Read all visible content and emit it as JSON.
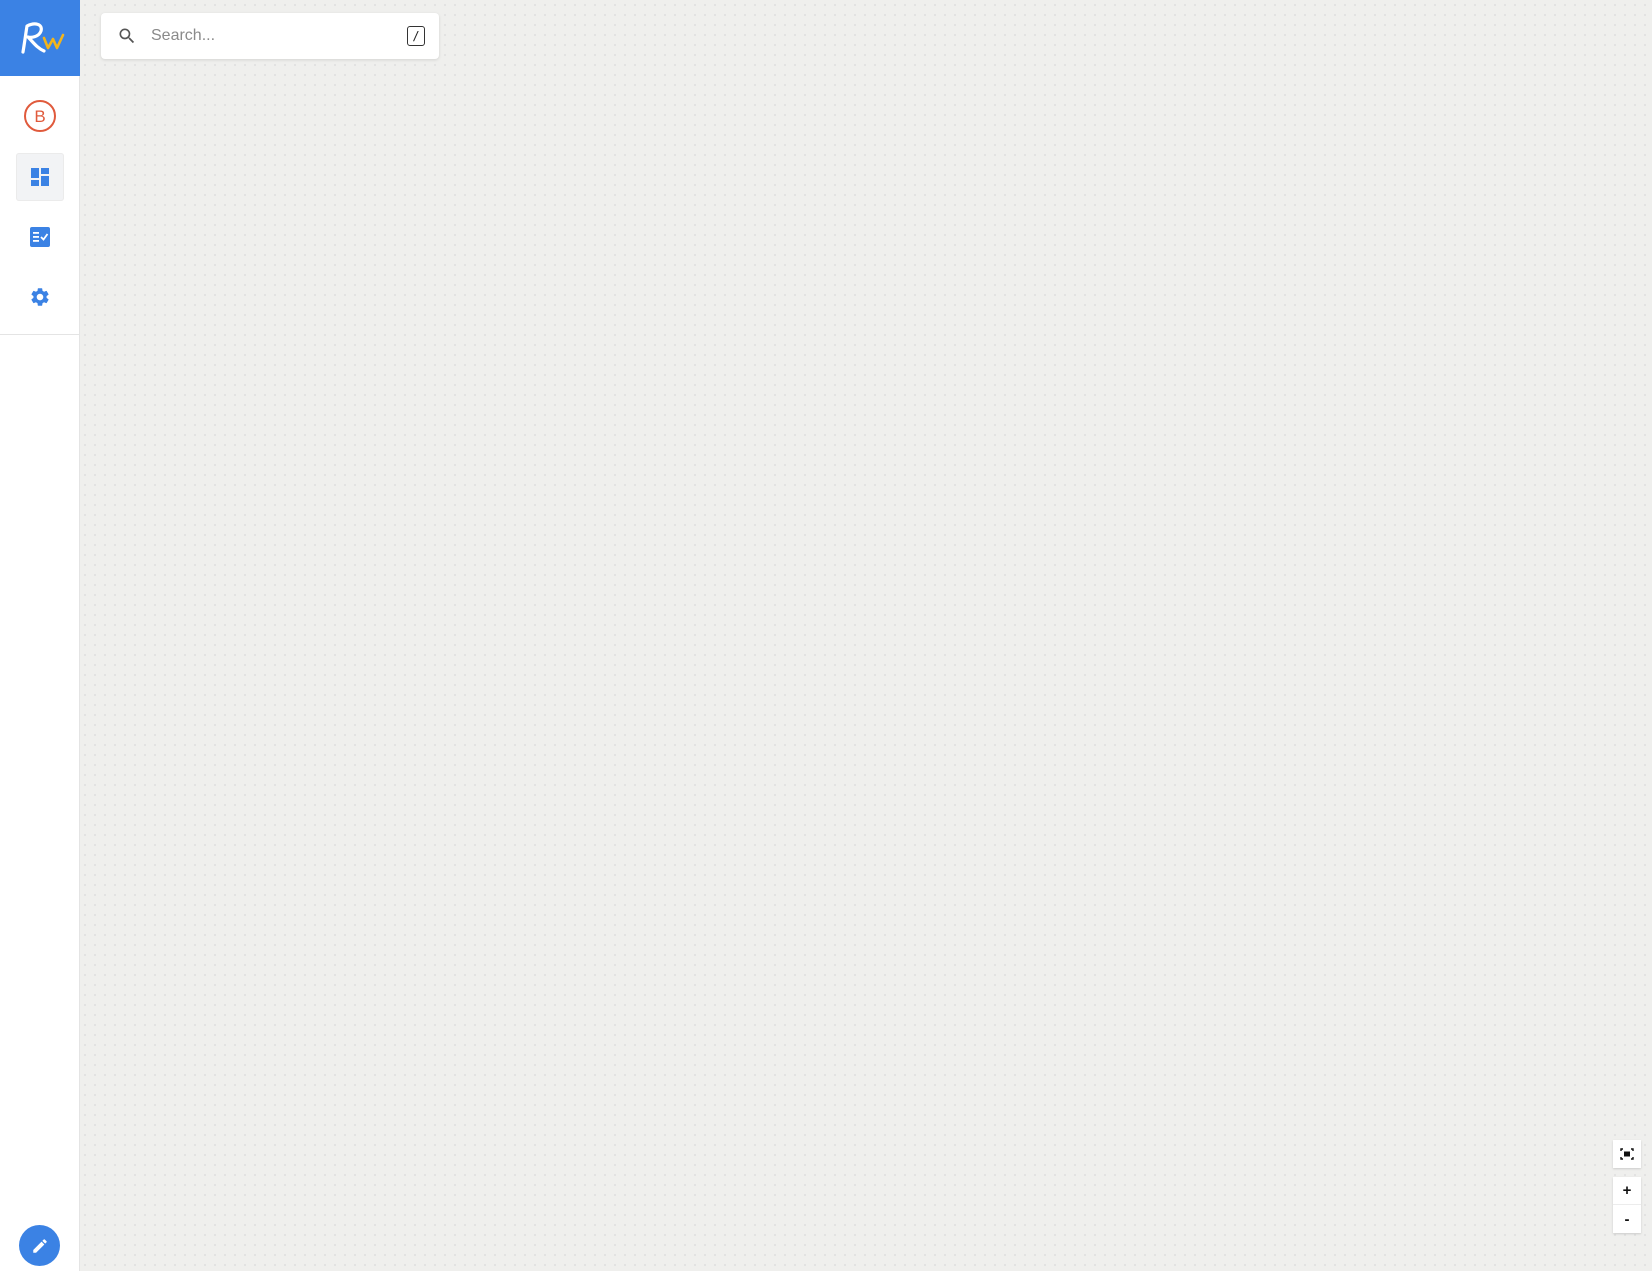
{
  "sidebar": {
    "logo_icon": "rw-logo-icon",
    "items": [
      {
        "name": "b-circle-icon",
        "color": "#e05a3c"
      },
      {
        "name": "dashboard-icon",
        "color": "#3b82e4",
        "active": true
      },
      {
        "name": "checklist-icon",
        "color": "#3b82e4"
      },
      {
        "name": "gear-icon",
        "color": "#3b82e4"
      }
    ],
    "profile_letter": "B",
    "fab_icon": "pencil-icon"
  },
  "search": {
    "placeholder": "Search...",
    "shortcut": "/"
  },
  "zoom": {
    "zoom_in_label": "+",
    "zoom_out_label": "-"
  },
  "colors": {
    "accent": "#3b82e4",
    "logo_w": "#f2b51c",
    "badge": "#e05a3c",
    "canvas": "#efefed"
  }
}
